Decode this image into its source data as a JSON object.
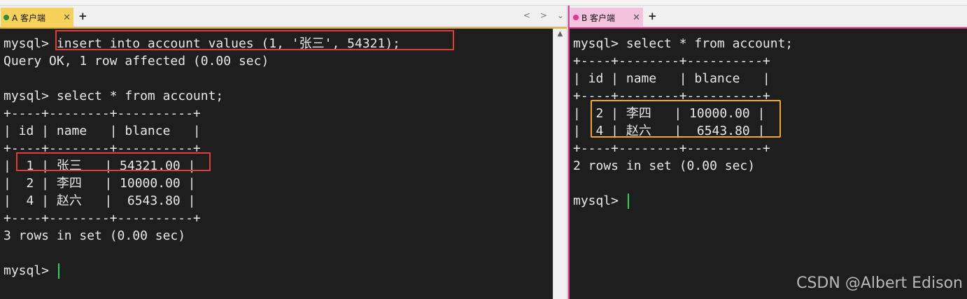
{
  "window": {
    "left_tab": "A 客户端",
    "right_tab": "B 客户端"
  },
  "tab_controls": {
    "new_tab": "+",
    "close": "✕",
    "prev": "<",
    "next": ">",
    "menu": "⌄",
    "scroll_up": "▲"
  },
  "terminal_a": {
    "lines": [
      "mysql> insert into account values (1, '张三', 54321);",
      "Query OK, 1 row affected (0.00 sec)",
      "",
      "mysql> select * from account;",
      "+----+--------+----------+",
      "| id | name   | blance   |",
      "+----+--------+----------+",
      "|  1 | 张三   | 54321.00 |",
      "|  2 | 李四   | 10000.00 |",
      "|  4 | 赵六   |  6543.80 |",
      "+----+--------+----------+",
      "3 rows in set (0.00 sec)",
      "",
      "mysql> "
    ]
  },
  "terminal_b": {
    "lines": [
      "mysql> select * from account;",
      "+----+--------+----------+",
      "| id | name   | blance   |",
      "+----+--------+----------+",
      "|  2 | 李四   | 10000.00 |",
      "|  4 | 赵六   |  6543.80 |",
      "+----+--------+----------+",
      "2 rows in set (0.00 sec)",
      "",
      "mysql> "
    ]
  },
  "watermark": "CSDN @Albert Edison",
  "colors": {
    "tab_a": "#f7d25b",
    "tab_b": "#f3c2dc",
    "highlight_red": "#e23b3b",
    "highlight_orange": "#f5a623",
    "cursor": "#1ed760"
  }
}
